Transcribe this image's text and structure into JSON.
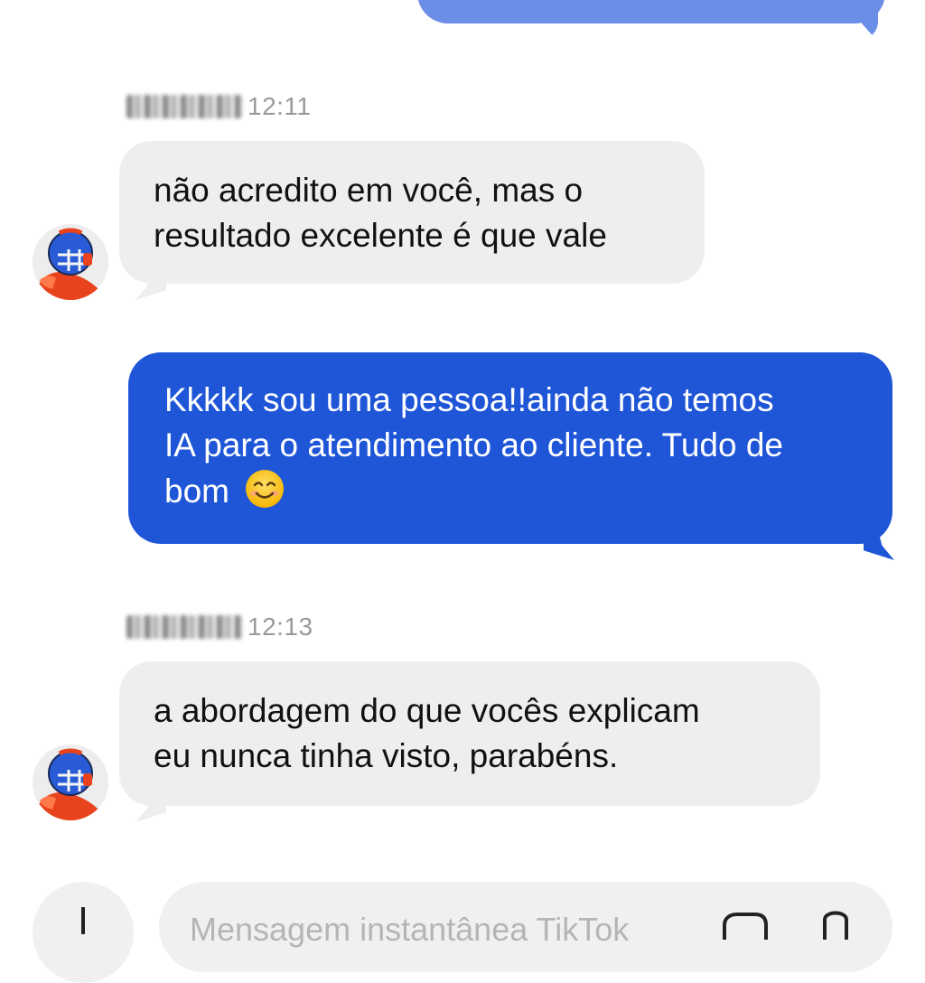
{
  "messages": [
    {
      "direction": "outgoing-partial",
      "text": ""
    },
    {
      "direction": "incoming",
      "sender_name_blurred": true,
      "time": "12:11",
      "lines": [
        "não acredito em você, mas o",
        "resultado excelente é que vale"
      ]
    },
    {
      "direction": "outgoing",
      "lines": [
        "Kkkkk sou uma pessoa!!ainda não temos",
        "IA para o atendimento ao cliente. Tudo de",
        "bom"
      ],
      "emoji": "smiling-face-emoji"
    },
    {
      "direction": "incoming",
      "sender_name_blurred": true,
      "time": "12:13",
      "lines": [
        "a abordagem do que vocês explicam",
        "eu nunca tinha visto, parabéns."
      ]
    }
  ],
  "composer": {
    "placeholder": "Mensagem instantânea TikTok",
    "plus_icon": "plus-icon",
    "sticker_icon": "sticker-icon",
    "mic_icon": "microphone-icon"
  },
  "colors": {
    "incoming_bubble": "#eeeeee",
    "outgoing_bubble": "#1f56d8",
    "previous_outgoing_bubble": "#6b8ee6",
    "timestamp": "#9a9a9a"
  }
}
